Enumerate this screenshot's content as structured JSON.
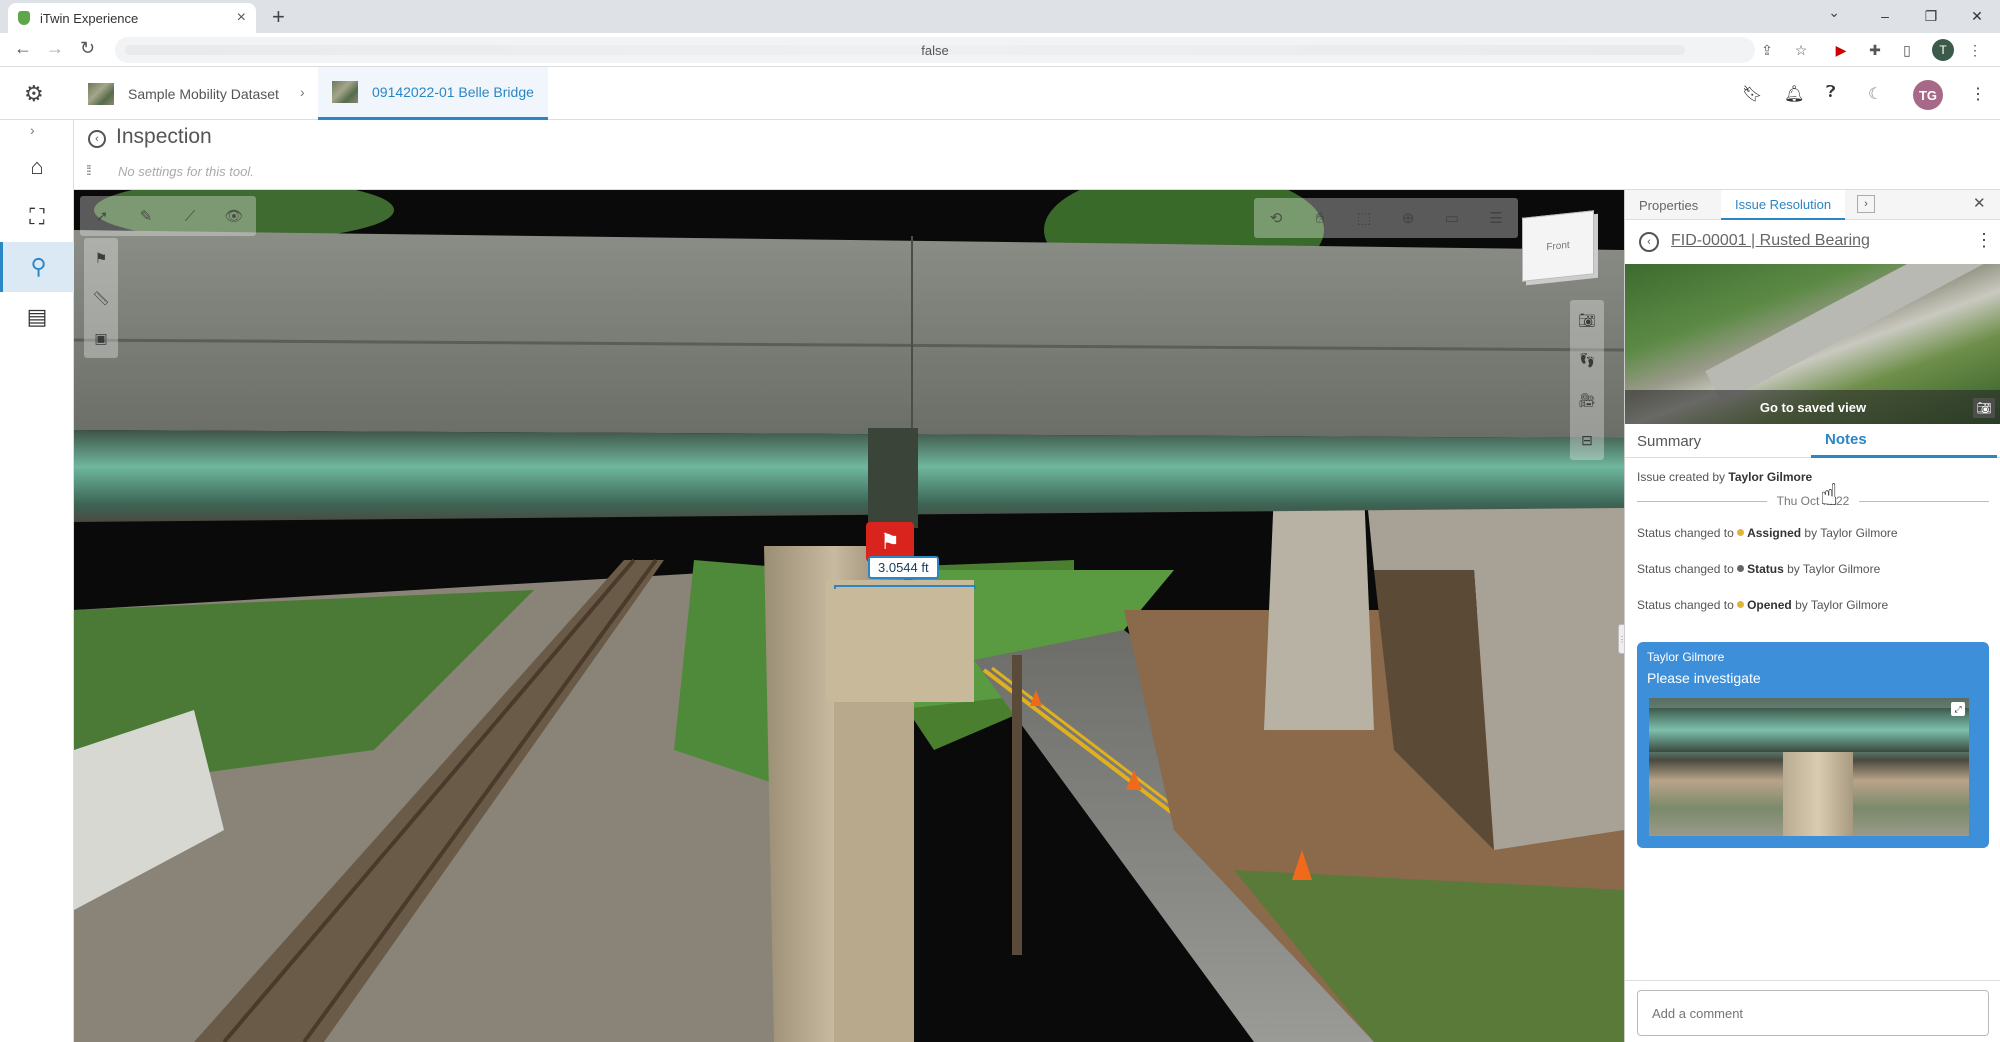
{
  "browser": {
    "tab_title": "iTwin Experience",
    "tab_close": "×",
    "new_tab": "+",
    "address_text": "false",
    "profile_initial": "T",
    "window_controls": {
      "minimize": "–",
      "restore": "❐",
      "close": "✕"
    }
  },
  "header": {
    "breadcrumb_1": "Sample Mobility Dataset",
    "breadcrumb_sep": "›",
    "breadcrumb_2": "09142022-01 Belle Bridge",
    "avatar_initials": "TG"
  },
  "tool": {
    "title": "Inspection",
    "note": "No settings for this tool."
  },
  "viewport": {
    "viewcube_label": "Front",
    "measurement": "3.0544 ft"
  },
  "panel": {
    "tabs": [
      "Properties",
      "Issue Resolution"
    ],
    "active_tab": "Issue Resolution",
    "issue_title": "FID-00001 | Rusted Bearing",
    "saved_view_label": "Go to saved view",
    "sub_tabs": [
      "Summary",
      "Notes"
    ],
    "active_sub_tab": "Notes",
    "notes": {
      "created_prefix": "Issue created by ",
      "created_by": "Taylor Gilmore",
      "date": "Thu Oct ... 22",
      "events": [
        {
          "prefix": "Status changed to ",
          "status": "Assigned",
          "suffix": " by Taylor Gilmore",
          "color": "#e0b43c"
        },
        {
          "prefix": "Status changed to ",
          "status": "Status",
          "suffix": " by Taylor Gilmore",
          "color": "#666666"
        },
        {
          "prefix": "Status changed to ",
          "status": "Opened",
          "suffix": " by Taylor Gilmore",
          "color": "#e0b43c"
        }
      ]
    },
    "comment": {
      "author": "Taylor Gilmore",
      "text": "Please investigate"
    },
    "comment_placeholder": "Add a comment"
  },
  "colors": {
    "accent": "#2b86c5",
    "flag": "#d8241c",
    "comment_card": "#3d8fd9"
  }
}
